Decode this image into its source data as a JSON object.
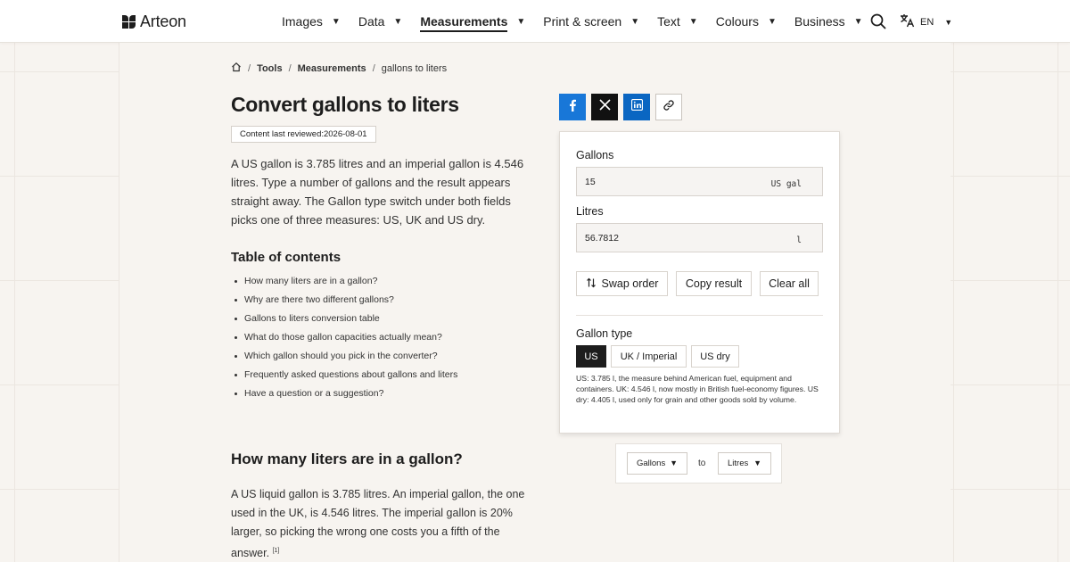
{
  "brand": {
    "name": "Arteon"
  },
  "nav": {
    "items": [
      {
        "label": "Images"
      },
      {
        "label": "Data"
      },
      {
        "label": "Measurements",
        "active": true
      },
      {
        "label": "Print & screen"
      },
      {
        "label": "Text"
      },
      {
        "label": "Colours"
      },
      {
        "label": "Business"
      }
    ],
    "caret": "▼",
    "lang": "EN"
  },
  "breadcrumb": {
    "items": [
      "Tools",
      "Measurements"
    ],
    "current": "gallons to liters",
    "separator": "/"
  },
  "article": {
    "title": "Convert gallons to liters",
    "reviewed": "Content last reviewed:2026-08-01",
    "intro": "A US gallon is 3.785 litres and an imperial gallon is 4.546 litres. Type a number of gallons and the result appears straight away. The Gallon type switch under both fields picks one of three measures: US, UK and US dry.",
    "toc_title": "Table of contents",
    "toc": [
      "How many liters are in a gallon?",
      "Why are there two different gallons?",
      "Gallons to liters conversion table",
      "What do those gallon capacities actually mean?",
      "Which gallon should you pick in the converter?",
      "Frequently asked questions about gallons and liters",
      "Have a question or a suggestion?"
    ],
    "section_title": "How many liters are in a gallon?",
    "section_text": "A US liquid gallon is 3.785 litres. An imperial gallon, the one used in the UK, is 4.546 litres. The imperial gallon is 20% larger, so picking the wrong one costs you a fifth of the answer.",
    "footnote": "[1]"
  },
  "converter": {
    "from_label": "Gallons",
    "from_value": "15",
    "from_unit": "US gal",
    "to_label": "Litres",
    "to_value": "56.7812",
    "to_unit": "l",
    "swap": "Swap order",
    "copy": "Copy result",
    "clear": "Clear all",
    "gallon_type_label": "Gallon type",
    "gallon_types": [
      "US",
      "UK / Imperial",
      "US dry"
    ],
    "selected_type": "US",
    "help": "US: 3.785 l, the measure behind American fuel, equipment and containers. UK: 4.546 l, now mostly in British fuel-economy figures. US dry: 4.405 l, used only for grain and other goods sold by volume."
  },
  "unit_selector": {
    "from": "Gallons",
    "to_word": "to",
    "to": "Litres"
  },
  "colors": {
    "accent_dark": "#1d1d1d",
    "facebook": "#1877d8",
    "linkedin": "#0a66c2",
    "x": "#111111",
    "background": "#f7f4f0"
  },
  "icons": [
    "logo-icon",
    "search-icon",
    "translate-icon",
    "home-icon",
    "facebook-icon",
    "x-icon",
    "linkedin-icon",
    "link-icon",
    "swap-icon"
  ]
}
